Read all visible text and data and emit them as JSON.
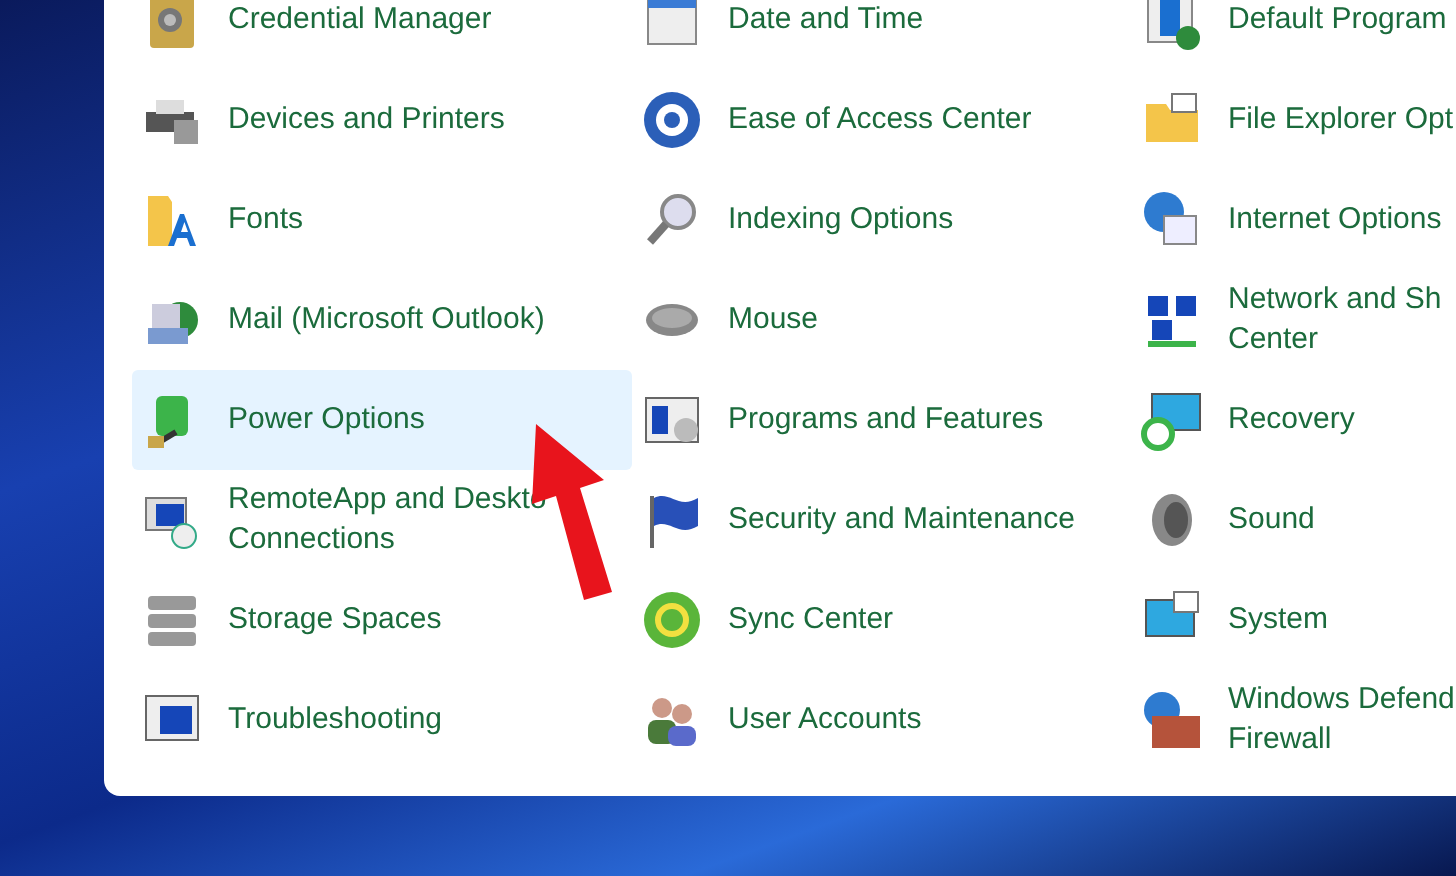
{
  "columns": [
    {
      "items": [
        {
          "lines": [
            "Credential Manager"
          ],
          "selected": false
        },
        {
          "lines": [
            "Devices and Printers"
          ],
          "selected": false
        },
        {
          "lines": [
            "Fonts"
          ],
          "selected": false
        },
        {
          "lines": [
            "Mail (Microsoft Outlook)"
          ],
          "selected": false
        },
        {
          "lines": [
            "Power Options"
          ],
          "selected": true
        },
        {
          "lines": [
            "RemoteApp and Deskto",
            "Connections"
          ],
          "selected": false
        },
        {
          "lines": [
            "Storage Spaces"
          ],
          "selected": false
        },
        {
          "lines": [
            "Troubleshooting"
          ],
          "selected": false
        }
      ]
    },
    {
      "items": [
        {
          "lines": [
            "Date and Time"
          ],
          "selected": false
        },
        {
          "lines": [
            "Ease of Access Center"
          ],
          "selected": false
        },
        {
          "lines": [
            "Indexing Options"
          ],
          "selected": false
        },
        {
          "lines": [
            "Mouse"
          ],
          "selected": false
        },
        {
          "lines": [
            "Programs and Features"
          ],
          "selected": false
        },
        {
          "lines": [
            "Security and Maintenance"
          ],
          "selected": false
        },
        {
          "lines": [
            "Sync Center"
          ],
          "selected": false
        },
        {
          "lines": [
            "User Accounts"
          ],
          "selected": false
        }
      ]
    },
    {
      "items": [
        {
          "lines": [
            "Default Program"
          ],
          "selected": false
        },
        {
          "lines": [
            "File Explorer Opt"
          ],
          "selected": false
        },
        {
          "lines": [
            "Internet Options"
          ],
          "selected": false
        },
        {
          "lines": [
            "Network and Sh",
            "Center"
          ],
          "selected": false
        },
        {
          "lines": [
            "Recovery"
          ],
          "selected": false
        },
        {
          "lines": [
            "Sound"
          ],
          "selected": false
        },
        {
          "lines": [
            "System"
          ],
          "selected": false
        },
        {
          "lines": [
            "Windows Defend",
            "Firewall"
          ],
          "selected": false
        }
      ]
    }
  ]
}
